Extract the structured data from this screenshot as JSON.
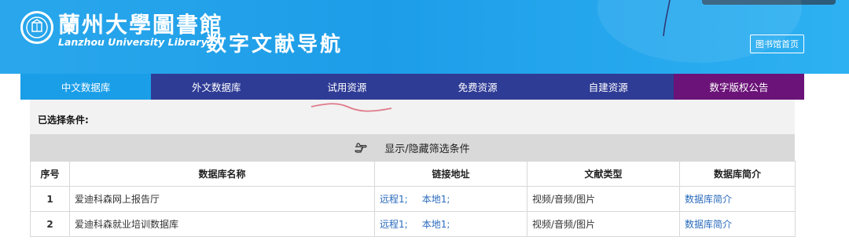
{
  "header": {
    "logo_cn": "蘭州大學圖書館",
    "logo_en": "Lanzhou University Library",
    "subtitle": "数字文献导航",
    "home_button": "图书馆首页",
    "bg_color": "#1d9de8"
  },
  "nav": {
    "items": [
      {
        "label": "中文数据库",
        "active": true
      },
      {
        "label": "外文数据库"
      },
      {
        "label": "试用资源"
      },
      {
        "label": "免费资源"
      },
      {
        "label": "自建资源"
      },
      {
        "label": "数字版权公告"
      }
    ]
  },
  "filter": {
    "selected_label": "已选择条件:",
    "toggle_label": "显示/隐藏筛选条件",
    "toggle_icon": "pointing-hand-icon"
  },
  "table": {
    "headers": [
      "序号",
      "数据库名称",
      "链接地址",
      "文献类型",
      "数据库简介"
    ],
    "rows": [
      {
        "num": "1",
        "name": "爱迪科森网上报告厅",
        "remote": "远程1;",
        "local": "本地1;",
        "type": "视频/音频/图片",
        "intro": "数据库简介"
      },
      {
        "num": "2",
        "name": "爱迪科森就业培训数据库",
        "remote": "远程1;",
        "local": "本地1;",
        "type": "视频/音频/图片",
        "intro": "数据库简介"
      }
    ]
  }
}
